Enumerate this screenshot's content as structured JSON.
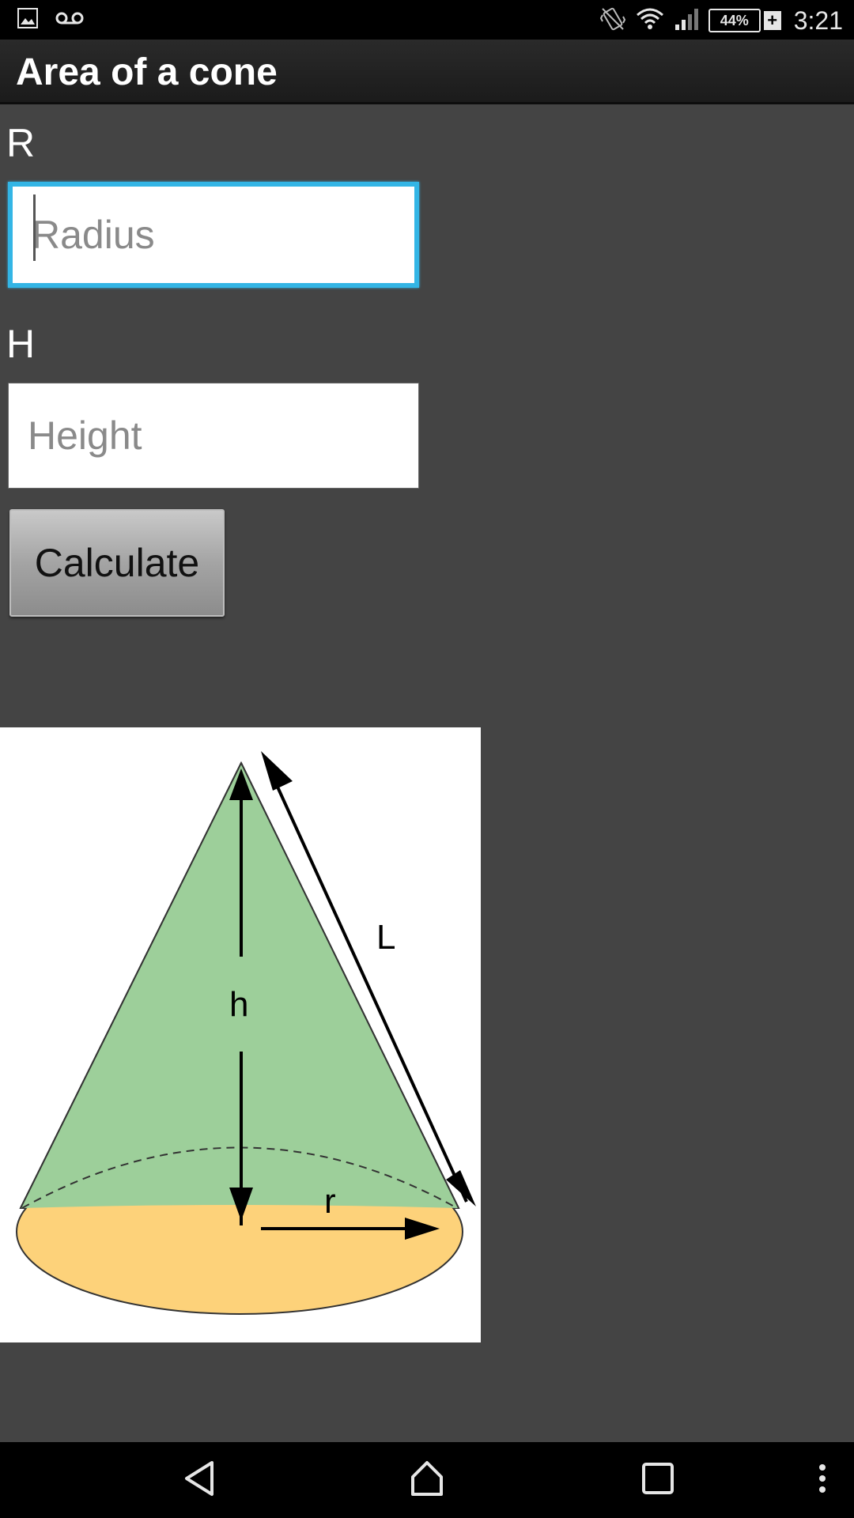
{
  "status_bar": {
    "time": "3:21",
    "battery_percent": "44%",
    "icons": [
      "image-icon",
      "voicemail-icon",
      "vibrate-icon",
      "wifi-icon",
      "signal-icon",
      "battery-icon",
      "charging-plus-icon"
    ]
  },
  "app": {
    "title": "Area of a cone"
  },
  "form": {
    "radius_label": "R",
    "radius_placeholder": "Radius",
    "radius_value": "",
    "height_label": "H",
    "height_placeholder": "Height",
    "height_value": "",
    "calculate_label": "Calculate"
  },
  "figure": {
    "height_symbol": "h",
    "slant_symbol": "L",
    "radius_symbol": "r",
    "cone_color": "#9dcf9a",
    "base_color": "#fdd27a"
  },
  "nav_bar": {
    "icons": [
      "back-icon",
      "home-icon",
      "recents-icon",
      "overflow-menu-icon"
    ]
  },
  "colors": {
    "focus_accent": "#33b5e5",
    "background": "#444444"
  }
}
